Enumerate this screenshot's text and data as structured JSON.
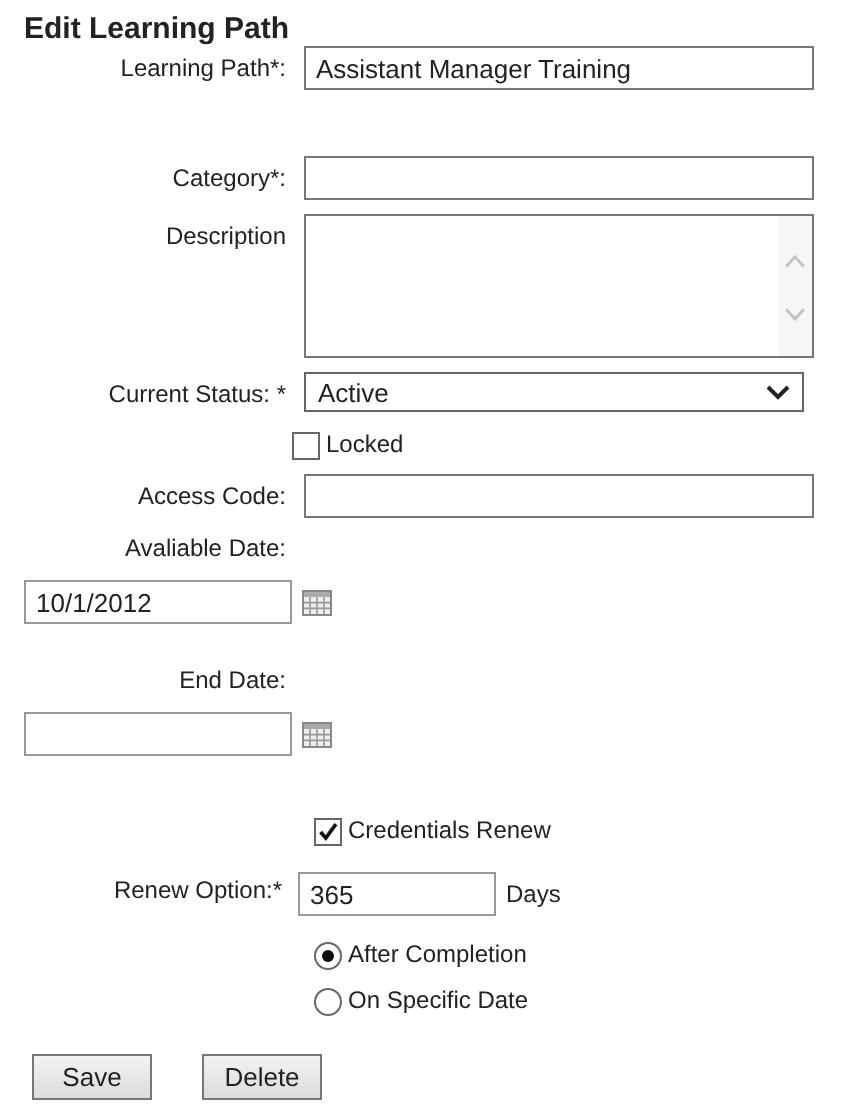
{
  "title": "Edit Learning Path",
  "fields": [
    {
      "kind": "text",
      "label": "Learning Path*:",
      "value": "Assistant Manager Training"
    },
    {
      "kind": "text",
      "label": "Category*:"
    },
    {
      "kind": "textarea",
      "label": "Description"
    },
    {
      "kind": "select",
      "label": "Current Status: *",
      "value": "Active"
    },
    {
      "kind": "checkbox",
      "label": "Locked",
      "checked": false
    },
    {
      "kind": "text",
      "label": "Access Code:"
    },
    {
      "kind": "date",
      "label": "Avaliable Date:",
      "value": "10/1/2012"
    },
    {
      "kind": "date",
      "label": "End Date:"
    },
    {
      "kind": "checkbox",
      "label": "Credentials Renew",
      "checked": true
    },
    {
      "kind": "number",
      "label": "Renew Option:*",
      "value": "365",
      "unit": "Days"
    },
    {
      "kind": "radio",
      "label": "After Completion",
      "selected": true
    },
    {
      "kind": "radio",
      "label": "On Specific Date",
      "selected": false
    }
  ],
  "buttons": [
    "Save",
    "Delete"
  ]
}
